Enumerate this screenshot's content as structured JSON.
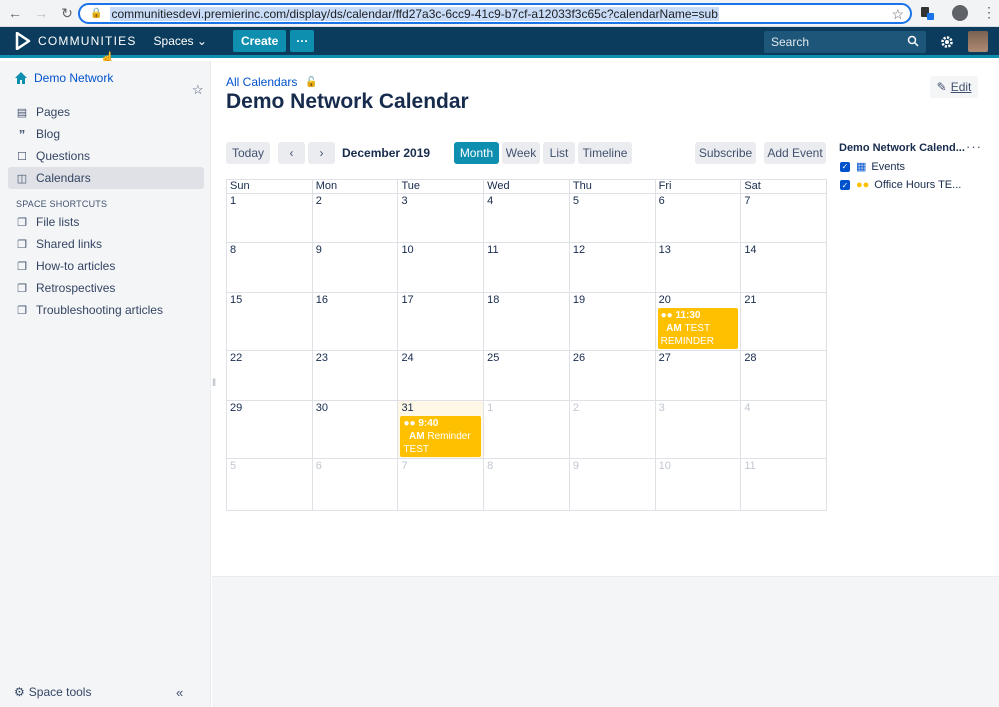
{
  "browser": {
    "url": "communitiesdevi.premierinc.com/display/ds/calendar/ffd27a3c-6cc9-41c9-b7cf-a12033f3c65c?calendarName=sub"
  },
  "header": {
    "logo_text": "COMMUNITIES",
    "spaces_label": "Spaces",
    "create_label": "Create",
    "search_placeholder": "Search",
    "colors": {
      "bar": "#0b3c5d",
      "accent": "#0e8fb0"
    }
  },
  "sidebar": {
    "space_name": "Demo Network",
    "items": [
      {
        "label": "Pages",
        "icon": "pages-icon"
      },
      {
        "label": "Blog",
        "icon": "quote-icon"
      },
      {
        "label": "Questions",
        "icon": "question-icon"
      },
      {
        "label": "Calendars",
        "icon": "calendar-icon"
      }
    ],
    "shortcuts_heading": "SPACE SHORTCUTS",
    "shortcuts": [
      {
        "label": "File lists"
      },
      {
        "label": "Shared links"
      },
      {
        "label": "How-to articles"
      },
      {
        "label": "Retrospectives"
      },
      {
        "label": "Troubleshooting articles"
      }
    ],
    "space_tools_label": "Space tools"
  },
  "main": {
    "breadcrumb": "All Calendars",
    "title": "Demo Network Calendar",
    "edit_label": "Edit",
    "toolbar": {
      "today": "Today",
      "prev": "‹",
      "next": "›",
      "month_label": "December 2019",
      "views": [
        "Month",
        "Week",
        "List",
        "Timeline"
      ],
      "active_view": "Month",
      "subscribe": "Subscribe",
      "add_event": "Add Event"
    },
    "calendar": {
      "weekdays": [
        "Sun",
        "Mon",
        "Tue",
        "Wed",
        "Thu",
        "Fri",
        "Sat"
      ],
      "weeks": [
        [
          "1",
          "2",
          "3",
          "4",
          "5",
          "6",
          "7"
        ],
        [
          "8",
          "9",
          "10",
          "11",
          "12",
          "13",
          "14"
        ],
        [
          "15",
          "16",
          "17",
          "18",
          "19",
          "20",
          "21"
        ],
        [
          "22",
          "23",
          "24",
          "25",
          "26",
          "27",
          "28"
        ],
        [
          "29",
          "30",
          "31",
          "1",
          "2",
          "3",
          "4"
        ],
        [
          "5",
          "6",
          "7",
          "8",
          "9",
          "10",
          "11"
        ]
      ],
      "events": [
        {
          "week": 2,
          "day": 5,
          "time": "11:30",
          "ampm": "AM",
          "title": "TEST REMINDER",
          "color": "#ffc000"
        },
        {
          "week": 4,
          "day": 2,
          "time": "9:40",
          "ampm": "AM",
          "title": "Reminder TEST",
          "color": "#ffc000"
        }
      ]
    }
  },
  "panel": {
    "title": "Demo Network Calend...",
    "calendars": [
      {
        "label": "Events",
        "icon": "calendar-blue-icon"
      },
      {
        "label": "Office Hours TE...",
        "icon": "people-icon"
      }
    ]
  }
}
